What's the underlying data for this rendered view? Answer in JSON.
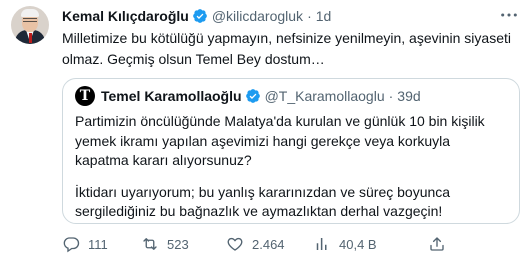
{
  "author": {
    "name": "Kemal Kılıçdaroğlu",
    "handle": "@kilicdarogluk",
    "separator": "·",
    "time": "1d"
  },
  "tweet_text": "Milletimize bu kötülüğü yapmayın, nefsinize yenilmeyin, aşevinin siyaseti olmaz. Geçmiş olsun Temel Bey dostum…",
  "quoted": {
    "avatar_letter": "T",
    "name": "Temel Karamollaoğlu",
    "handle": "@T_Karamollaoglu",
    "separator": "·",
    "time": "39d",
    "paragraph1": "Partimizin öncülüğünde Malatya'da kurulan ve günlük 10 bin kişilik yemek ikramı yapılan aşevimizi hangi gerekçe veya korkuyla kapatma kararı alıyorsunuz?",
    "paragraph2": "İktidarı uyarıyorum; bu yanlış kararınızdan ve süreç boyunca sergilediğiniz bu bağnazlık ve aymazlıktan derhal vazgeçin!"
  },
  "actions": {
    "replies": "111",
    "retweets": "523",
    "likes": "2.464",
    "views": "40,4 B"
  },
  "icons": {
    "verified": "verified-badge-icon",
    "more": "more-options-icon",
    "reply": "reply-icon",
    "retweet": "retweet-icon",
    "like": "heart-icon",
    "views": "views-chart-icon",
    "share": "share-icon"
  },
  "colors": {
    "verified": "#1d9bf0",
    "text": "#0f1419",
    "secondary": "#536471",
    "border": "#cfd9de"
  }
}
